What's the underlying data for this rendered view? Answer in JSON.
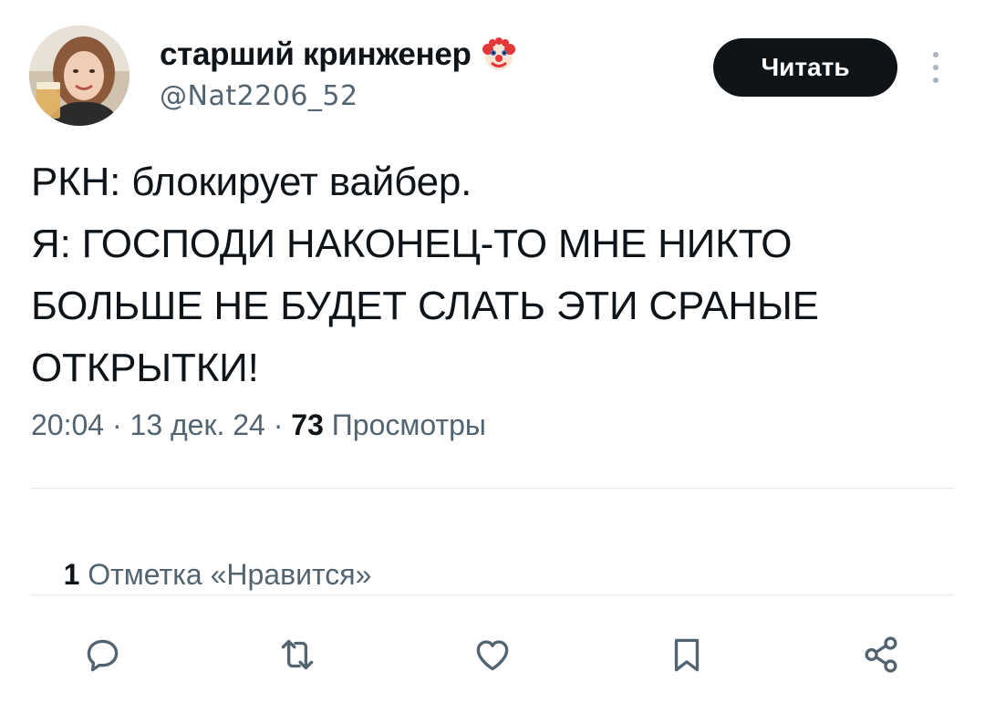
{
  "author": {
    "display_name": "старший кринженер",
    "handle": "@Nat2206_52",
    "name_emoji": "clown-face-emoji",
    "avatar": "profile-photo"
  },
  "header": {
    "follow_label": "Читать",
    "more_icon": "more-vertical-icon"
  },
  "tweet": {
    "text": "РКН: блокирует вайбер.\nЯ: ГОСПОДИ НАКОНЕЦ-ТО МНЕ НИКТО БОЛЬШЕ НЕ БУДЕТ СЛАТЬ ЭТИ СРАНЫЕ ОТКРЫТКИ!",
    "time": "20:04",
    "date": "13 дек. 24",
    "separator": " · ",
    "views_count": "73",
    "views_label": "Просмотры"
  },
  "engagement": {
    "likes_count": "1",
    "likes_label": "Отметка «Нравится»"
  },
  "actions": [
    {
      "name": "reply",
      "icon": "reply-bubble-icon"
    },
    {
      "name": "retweet",
      "icon": "retweet-icon"
    },
    {
      "name": "like",
      "icon": "heart-icon"
    },
    {
      "name": "bookmark",
      "icon": "bookmark-icon"
    },
    {
      "name": "share",
      "icon": "share-icon"
    }
  ],
  "colors": {
    "text_primary": "#0f1419",
    "text_secondary": "#536471",
    "button_bg": "#0f1419",
    "divider": "#e4e8eb"
  }
}
